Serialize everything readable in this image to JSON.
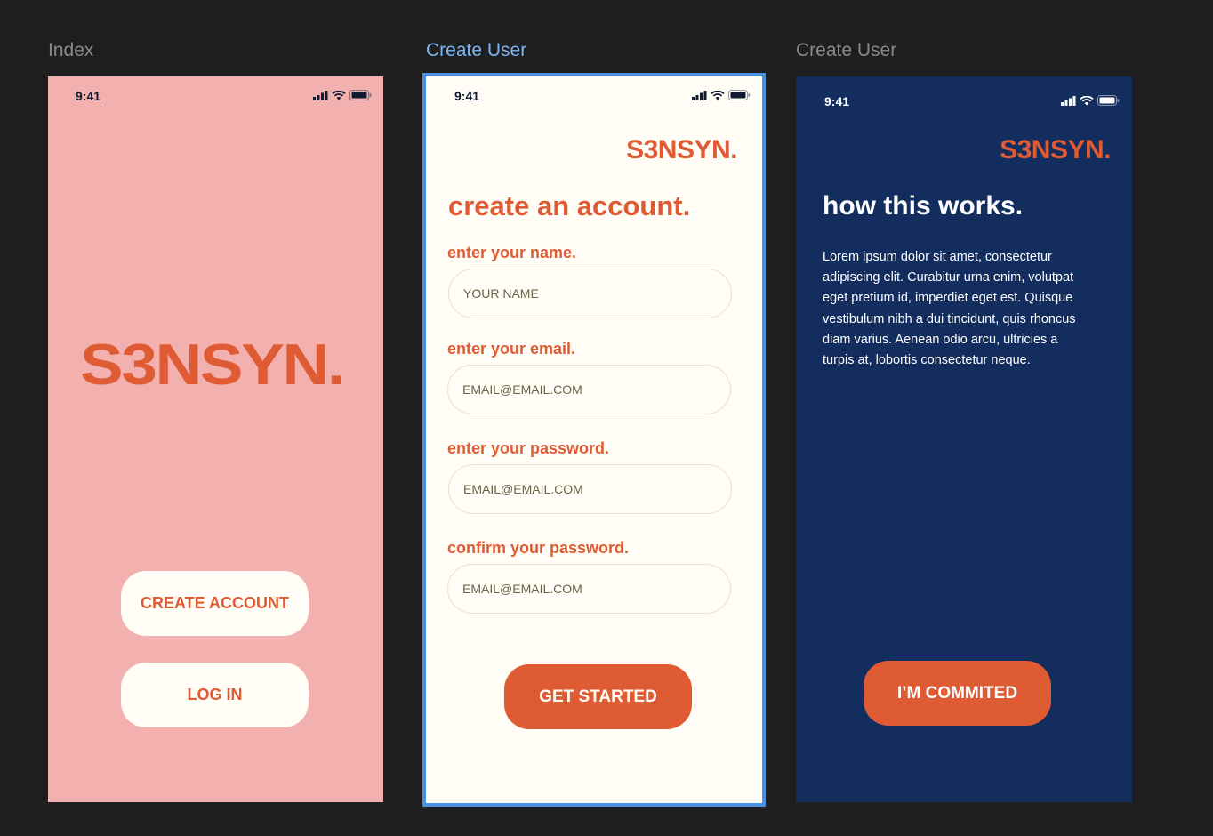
{
  "frames": {
    "index": {
      "label": "Index",
      "time": "9:41",
      "logo": "S3NSYN.",
      "create_account_label": "CREATE ACCOUNT",
      "log_in_label": "LOG IN"
    },
    "create_user": {
      "label": "Create User",
      "time": "9:41",
      "logo": "S3NSYN.",
      "heading": "create an account.",
      "fields": [
        {
          "label": "enter your name.",
          "placeholder": "YOUR NAME"
        },
        {
          "label": "enter your email.",
          "placeholder": "EMAIL@EMAIL.COM"
        },
        {
          "label": "enter your password.",
          "placeholder": "EMAIL@EMAIL.COM"
        },
        {
          "label": "confirm your password.",
          "placeholder": "EMAIL@EMAIL.COM"
        }
      ],
      "submit_label": "GET STARTED"
    },
    "how_it_works": {
      "label": "Create User",
      "time": "9:41",
      "logo": "S3NSYN.",
      "heading": "how this works.",
      "body": "Lorem ipsum dolor sit amet, consectetur adipiscing elit. Curabitur urna enim, volutpat eget pretium id, imperdiet eget est. Quisque vestibulum nibh a dui tincidunt, quis rhoncus diam varius. Aenean odio arcu, ultricies a turpis at, lobortis consectetur neque.",
      "commit_label": "I’M COMMITED"
    }
  },
  "colors": {
    "canvas": "#1e1e1e",
    "pink": "#f2b0ae",
    "cream": "#fffdf6",
    "navy": "#132d5e",
    "accent": "#df5b34",
    "selection": "#4a90e2"
  },
  "icons": [
    "signal-icon",
    "wifi-icon",
    "battery-icon"
  ]
}
